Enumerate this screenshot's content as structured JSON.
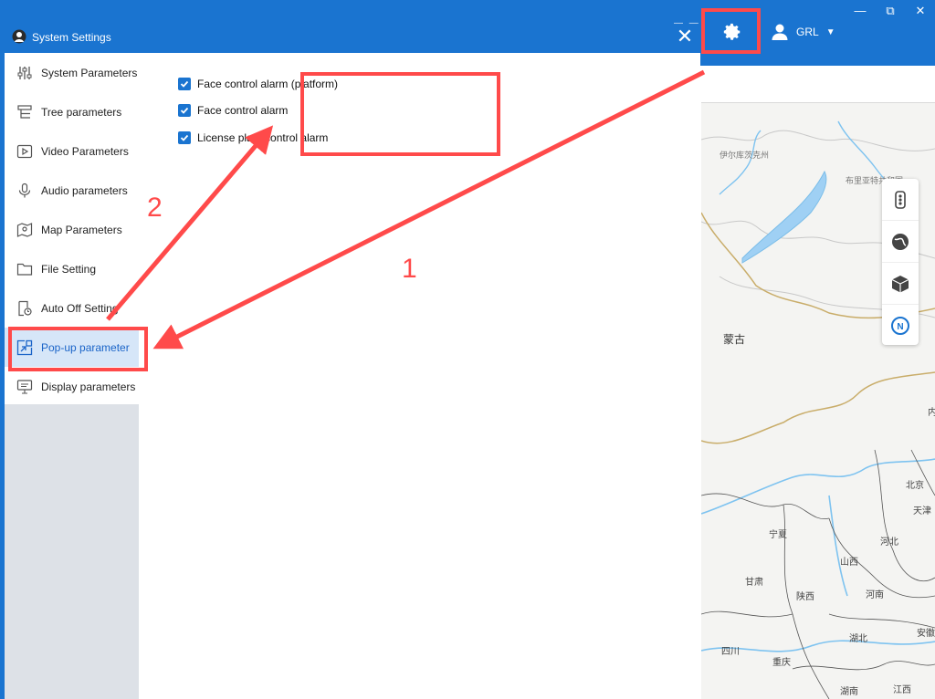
{
  "app": {
    "user_name": "GRL",
    "window_controls": [
      "—",
      "⧉",
      "✕"
    ]
  },
  "dialog": {
    "title": "System Settings",
    "close": "✕"
  },
  "sidebar": {
    "items": [
      {
        "label": "System Parameters",
        "icon": "sliders-icon"
      },
      {
        "label": "Tree parameters",
        "icon": "tree-icon"
      },
      {
        "label": "Video Parameters",
        "icon": "video-icon"
      },
      {
        "label": "Audio parameters",
        "icon": "microphone-icon"
      },
      {
        "label": "Map Parameters",
        "icon": "map-pin-icon"
      },
      {
        "label": "File Setting",
        "icon": "folder-icon"
      },
      {
        "label": "Auto Off Setting",
        "icon": "clock-doc-icon"
      },
      {
        "label": "Pop-up parameter",
        "icon": "popup-icon",
        "active": true
      },
      {
        "label": "Display parameters",
        "icon": "monitor-icon"
      }
    ]
  },
  "popup_settings": {
    "options": [
      {
        "label": "Face control alarm (platform)",
        "checked": true
      },
      {
        "label": "Face control alarm",
        "checked": true
      },
      {
        "label": "License plate control alarm",
        "checked": true
      }
    ]
  },
  "annotations": {
    "step1": "1",
    "step2": "2"
  },
  "map": {
    "labels": [
      "伊尔库茨克州",
      "布里亚特共和国",
      "蒙古",
      "宁夏",
      "甘肃",
      "陕西",
      "山西",
      "河北",
      "河南",
      "北京",
      "天津",
      "湖北",
      "四川",
      "重庆",
      "湖南",
      "江西",
      "安徽",
      "内"
    ]
  },
  "colors": {
    "brand_blue": "#1a74d0",
    "highlight_red": "#ff4a4a",
    "active_bg": "#d6e6f8"
  }
}
